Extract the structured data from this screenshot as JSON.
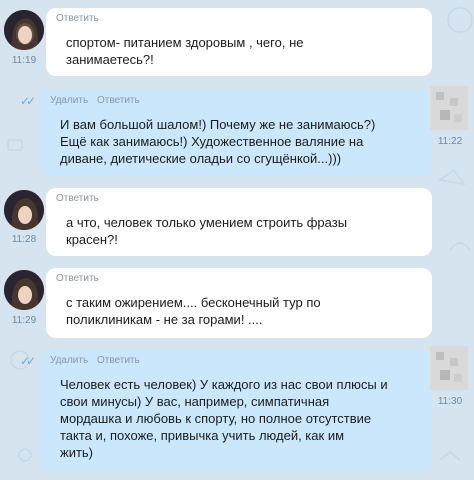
{
  "messages": [
    {
      "direction": "in",
      "time": "11:19",
      "actions": [
        "Ответить"
      ],
      "text": "спортом- питанием здоровым , чего, не\nзанимаетесь?!"
    },
    {
      "direction": "out",
      "time": "11:22",
      "actions": [
        "Удалить",
        "Ответить"
      ],
      "text": "И вам большой шалом!) Почему же не занимаюсь?)\nЕщё как занимаюсь!) Художественное валяние на\nдиване, диетические оладьи со сгущёнкой...)))"
    },
    {
      "direction": "in",
      "time": "11:28",
      "actions": [
        "Ответить"
      ],
      "text": "а что, человек только умением строить фразы\nкрасен?!"
    },
    {
      "direction": "in",
      "time": "11:29",
      "actions": [
        "Ответить"
      ],
      "text": "с таким ожирением.... бесконечный тур по\nполиклиникам - не за горами! ...."
    },
    {
      "direction": "out",
      "time": "11:30",
      "actions": [
        "Удалить",
        "Ответить"
      ],
      "text": "Человек есть человек) У каждого из нас свои плюсы и\nсвои минусы) У вас, например, симпатичная\nмордашка и любовь к спорту, но полное отсутствие\nтакта и, похоже, привычка учить людей, как им\nжить)"
    }
  ],
  "colors": {
    "background": "#d6e4ef",
    "incoming_bubble": "#ffffff",
    "outgoing_bubble": "#cbe7fb",
    "time_text": "#6b8aa3"
  }
}
